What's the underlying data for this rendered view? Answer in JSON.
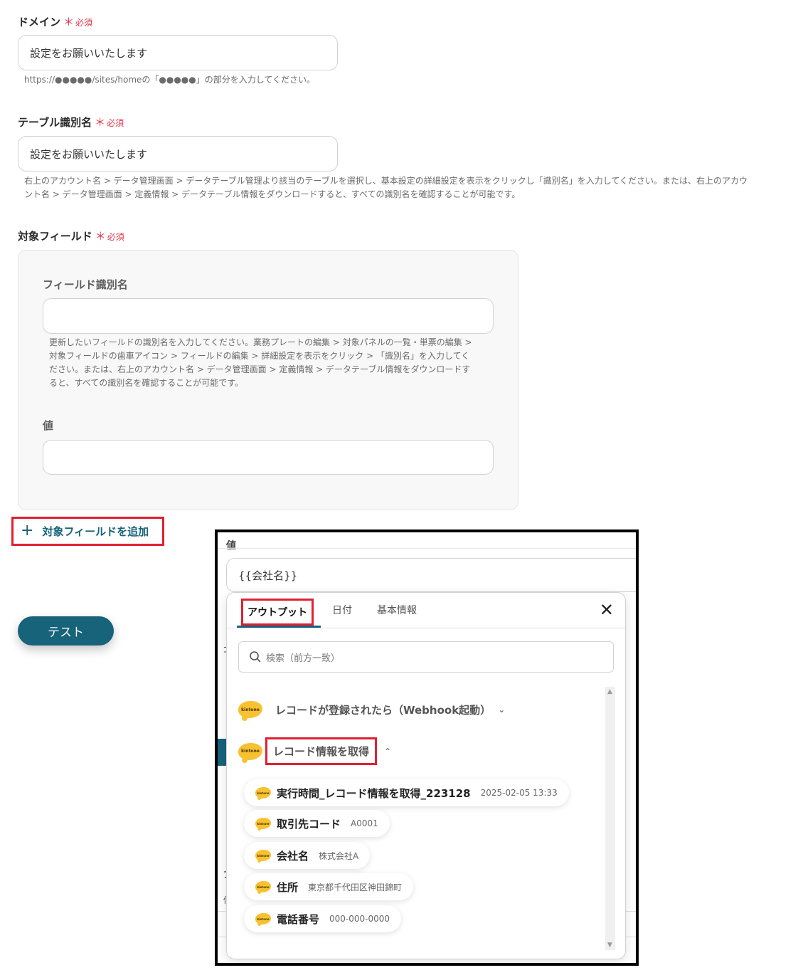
{
  "domain_field": {
    "label": "ドメイン",
    "required_mark": "＊",
    "required_text": "必須",
    "value": "設定をお願いいたします",
    "help": "https://●●●●●/sites/homeの「●●●●●」の部分を入力してください。"
  },
  "table_field": {
    "label": "テーブル識別名",
    "required_mark": "＊",
    "required_text": "必須",
    "value": "設定をお願いいたします",
    "help_line1": "右上のアカウント名 > データ管理画面 > データテーブル管理より該当のテーブルを選択し、基本設定の詳細設定を表示をクリックし「識別名」を入力してください。または、右上のアカウ",
    "help_line2": "ント名 > データ管理画面 > 定義情報 > データテーブル情報をダウンロードすると、すべての識別名を確認することが可能です。"
  },
  "target_field": {
    "label": "対象フィールド",
    "required_mark": "＊",
    "required_text": "必須",
    "field_id_label": "フィールド識別名",
    "field_id_value": "",
    "field_help_lines": [
      "更新したいフィールドの識別名を入力してください。業務プレートの編集 > 対象パネルの一覧・単票の編集 >",
      "対象フィールドの歯車アイコン > フィールドの編集 > 詳細設定を表示をクリック > 「識別名」を入力してく",
      "ださい。または、右上のアカウント名 > データ管理画面 > 定義情報 > データテーブル情報をダウンロードす",
      "ると、すべての識別名を確認することが可能です。"
    ],
    "value_label": "値",
    "value_value": ""
  },
  "add_field_button": {
    "plus": "+",
    "label": "対象フィールドを追加"
  },
  "test_button": {
    "label": "テスト"
  },
  "overlay": {
    "value_label": "値",
    "value_input": "{{会社名}}",
    "tabs": [
      "アウトプット",
      "日付",
      "基本情報"
    ],
    "close": "✕",
    "search_placeholder": "検索（前方一致）",
    "groups": [
      {
        "logo": "kintone",
        "title": "レコードが登録されたら（Webhook起動）",
        "chevron": "⌄"
      },
      {
        "logo": "kintone",
        "title": "レコード情報を取得",
        "chevron": "⌃"
      }
    ],
    "items": [
      {
        "name": "実行時間_レコード情報を取得_223128",
        "value": "2025-02-05 13:33"
      },
      {
        "name": "取引先コード",
        "value": "A0001"
      },
      {
        "name": "会社名",
        "value": "株式会社A"
      },
      {
        "name": "住所",
        "value": "東京都千代田区神田錦町"
      },
      {
        "name": "電話番号",
        "value": "000-000-0000"
      }
    ],
    "bg_fragments": [
      "ｺ",
      "ア",
      "値"
    ]
  },
  "colors": {
    "accent": "#16637a",
    "required": "#e0364a",
    "highlight": "#e02030",
    "logo": "#f7c230"
  }
}
